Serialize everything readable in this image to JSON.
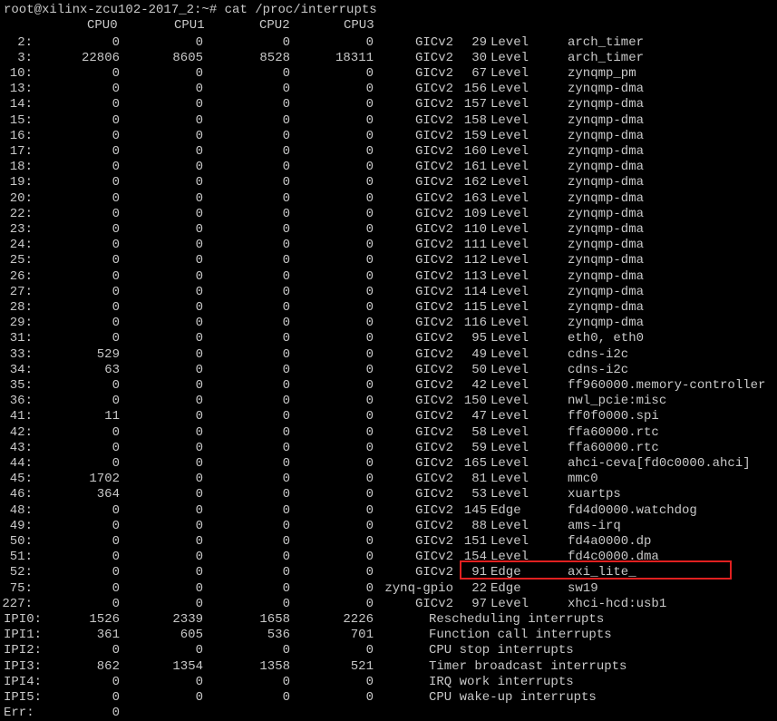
{
  "prompt": "root@xilinx-zcu102-2017_2:~# cat /proc/interrupts",
  "header": [
    "CPU0",
    "CPU1",
    "CPU2",
    "CPU3"
  ],
  "rows": [
    {
      "irq": "2:",
      "c0": "0",
      "c1": "0",
      "c2": "0",
      "c3": "0",
      "chip": "GICv2",
      "hw": "29",
      "type": "Level",
      "name": "arch_timer"
    },
    {
      "irq": "3:",
      "c0": "22806",
      "c1": "8605",
      "c2": "8528",
      "c3": "18311",
      "chip": "GICv2",
      "hw": "30",
      "type": "Level",
      "name": "arch_timer"
    },
    {
      "irq": "10:",
      "c0": "0",
      "c1": "0",
      "c2": "0",
      "c3": "0",
      "chip": "GICv2",
      "hw": "67",
      "type": "Level",
      "name": "zynqmp_pm"
    },
    {
      "irq": "13:",
      "c0": "0",
      "c1": "0",
      "c2": "0",
      "c3": "0",
      "chip": "GICv2",
      "hw": "156",
      "type": "Level",
      "name": "zynqmp-dma"
    },
    {
      "irq": "14:",
      "c0": "0",
      "c1": "0",
      "c2": "0",
      "c3": "0",
      "chip": "GICv2",
      "hw": "157",
      "type": "Level",
      "name": "zynqmp-dma"
    },
    {
      "irq": "15:",
      "c0": "0",
      "c1": "0",
      "c2": "0",
      "c3": "0",
      "chip": "GICv2",
      "hw": "158",
      "type": "Level",
      "name": "zynqmp-dma"
    },
    {
      "irq": "16:",
      "c0": "0",
      "c1": "0",
      "c2": "0",
      "c3": "0",
      "chip": "GICv2",
      "hw": "159",
      "type": "Level",
      "name": "zynqmp-dma"
    },
    {
      "irq": "17:",
      "c0": "0",
      "c1": "0",
      "c2": "0",
      "c3": "0",
      "chip": "GICv2",
      "hw": "160",
      "type": "Level",
      "name": "zynqmp-dma"
    },
    {
      "irq": "18:",
      "c0": "0",
      "c1": "0",
      "c2": "0",
      "c3": "0",
      "chip": "GICv2",
      "hw": "161",
      "type": "Level",
      "name": "zynqmp-dma"
    },
    {
      "irq": "19:",
      "c0": "0",
      "c1": "0",
      "c2": "0",
      "c3": "0",
      "chip": "GICv2",
      "hw": "162",
      "type": "Level",
      "name": "zynqmp-dma"
    },
    {
      "irq": "20:",
      "c0": "0",
      "c1": "0",
      "c2": "0",
      "c3": "0",
      "chip": "GICv2",
      "hw": "163",
      "type": "Level",
      "name": "zynqmp-dma"
    },
    {
      "irq": "22:",
      "c0": "0",
      "c1": "0",
      "c2": "0",
      "c3": "0",
      "chip": "GICv2",
      "hw": "109",
      "type": "Level",
      "name": "zynqmp-dma"
    },
    {
      "irq": "23:",
      "c0": "0",
      "c1": "0",
      "c2": "0",
      "c3": "0",
      "chip": "GICv2",
      "hw": "110",
      "type": "Level",
      "name": "zynqmp-dma"
    },
    {
      "irq": "24:",
      "c0": "0",
      "c1": "0",
      "c2": "0",
      "c3": "0",
      "chip": "GICv2",
      "hw": "111",
      "type": "Level",
      "name": "zynqmp-dma"
    },
    {
      "irq": "25:",
      "c0": "0",
      "c1": "0",
      "c2": "0",
      "c3": "0",
      "chip": "GICv2",
      "hw": "112",
      "type": "Level",
      "name": "zynqmp-dma"
    },
    {
      "irq": "26:",
      "c0": "0",
      "c1": "0",
      "c2": "0",
      "c3": "0",
      "chip": "GICv2",
      "hw": "113",
      "type": "Level",
      "name": "zynqmp-dma"
    },
    {
      "irq": "27:",
      "c0": "0",
      "c1": "0",
      "c2": "0",
      "c3": "0",
      "chip": "GICv2",
      "hw": "114",
      "type": "Level",
      "name": "zynqmp-dma"
    },
    {
      "irq": "28:",
      "c0": "0",
      "c1": "0",
      "c2": "0",
      "c3": "0",
      "chip": "GICv2",
      "hw": "115",
      "type": "Level",
      "name": "zynqmp-dma"
    },
    {
      "irq": "29:",
      "c0": "0",
      "c1": "0",
      "c2": "0",
      "c3": "0",
      "chip": "GICv2",
      "hw": "116",
      "type": "Level",
      "name": "zynqmp-dma"
    },
    {
      "irq": "31:",
      "c0": "0",
      "c1": "0",
      "c2": "0",
      "c3": "0",
      "chip": "GICv2",
      "hw": "95",
      "type": "Level",
      "name": "eth0, eth0"
    },
    {
      "irq": "33:",
      "c0": "529",
      "c1": "0",
      "c2": "0",
      "c3": "0",
      "chip": "GICv2",
      "hw": "49",
      "type": "Level",
      "name": "cdns-i2c"
    },
    {
      "irq": "34:",
      "c0": "63",
      "c1": "0",
      "c2": "0",
      "c3": "0",
      "chip": "GICv2",
      "hw": "50",
      "type": "Level",
      "name": "cdns-i2c"
    },
    {
      "irq": "35:",
      "c0": "0",
      "c1": "0",
      "c2": "0",
      "c3": "0",
      "chip": "GICv2",
      "hw": "42",
      "type": "Level",
      "name": "ff960000.memory-controller"
    },
    {
      "irq": "36:",
      "c0": "0",
      "c1": "0",
      "c2": "0",
      "c3": "0",
      "chip": "GICv2",
      "hw": "150",
      "type": "Level",
      "name": "nwl_pcie:misc"
    },
    {
      "irq": "41:",
      "c0": "11",
      "c1": "0",
      "c2": "0",
      "c3": "0",
      "chip": "GICv2",
      "hw": "47",
      "type": "Level",
      "name": "ff0f0000.spi"
    },
    {
      "irq": "42:",
      "c0": "0",
      "c1": "0",
      "c2": "0",
      "c3": "0",
      "chip": "GICv2",
      "hw": "58",
      "type": "Level",
      "name": "ffa60000.rtc"
    },
    {
      "irq": "43:",
      "c0": "0",
      "c1": "0",
      "c2": "0",
      "c3": "0",
      "chip": "GICv2",
      "hw": "59",
      "type": "Level",
      "name": "ffa60000.rtc"
    },
    {
      "irq": "44:",
      "c0": "0",
      "c1": "0",
      "c2": "0",
      "c3": "0",
      "chip": "GICv2",
      "hw": "165",
      "type": "Level",
      "name": "ahci-ceva[fd0c0000.ahci]"
    },
    {
      "irq": "45:",
      "c0": "1702",
      "c1": "0",
      "c2": "0",
      "c3": "0",
      "chip": "GICv2",
      "hw": "81",
      "type": "Level",
      "name": "mmc0"
    },
    {
      "irq": "46:",
      "c0": "364",
      "c1": "0",
      "c2": "0",
      "c3": "0",
      "chip": "GICv2",
      "hw": "53",
      "type": "Level",
      "name": "xuartps"
    },
    {
      "irq": "48:",
      "c0": "0",
      "c1": "0",
      "c2": "0",
      "c3": "0",
      "chip": "GICv2",
      "hw": "145",
      "type": "Edge",
      "name": "fd4d0000.watchdog"
    },
    {
      "irq": "49:",
      "c0": "0",
      "c1": "0",
      "c2": "0",
      "c3": "0",
      "chip": "GICv2",
      "hw": "88",
      "type": "Level",
      "name": "ams-irq"
    },
    {
      "irq": "50:",
      "c0": "0",
      "c1": "0",
      "c2": "0",
      "c3": "0",
      "chip": "GICv2",
      "hw": "151",
      "type": "Level",
      "name": "fd4a0000.dp"
    },
    {
      "irq": "51:",
      "c0": "0",
      "c1": "0",
      "c2": "0",
      "c3": "0",
      "chip": "GICv2",
      "hw": "154",
      "type": "Level",
      "name": "fd4c0000.dma"
    },
    {
      "irq": "52:",
      "c0": "0",
      "c1": "0",
      "c2": "0",
      "c3": "0",
      "chip": "GICv2",
      "hw": "91",
      "type": "Edge",
      "name": "axi_lite_"
    },
    {
      "irq": "75:",
      "c0": "0",
      "c1": "0",
      "c2": "0",
      "c3": "0",
      "chip": "zynq-gpio",
      "hw": "22",
      "type": "Edge",
      "name": "sw19"
    },
    {
      "irq": "227:",
      "c0": "0",
      "c1": "0",
      "c2": "0",
      "c3": "0",
      "chip": "GICv2",
      "hw": "97",
      "type": "Level",
      "name": "xhci-hcd:usb1"
    }
  ],
  "ipi_rows": [
    {
      "irq": "IPI0:",
      "c0": "1526",
      "c1": "2339",
      "c2": "1658",
      "c3": "2226",
      "desc": "Rescheduling interrupts"
    },
    {
      "irq": "IPI1:",
      "c0": "361",
      "c1": "605",
      "c2": "536",
      "c3": "701",
      "desc": "Function call interrupts"
    },
    {
      "irq": "IPI2:",
      "c0": "0",
      "c1": "0",
      "c2": "0",
      "c3": "0",
      "desc": "CPU stop interrupts"
    },
    {
      "irq": "IPI3:",
      "c0": "862",
      "c1": "1354",
      "c2": "1358",
      "c3": "521",
      "desc": "Timer broadcast interrupts"
    },
    {
      "irq": "IPI4:",
      "c0": "0",
      "c1": "0",
      "c2": "0",
      "c3": "0",
      "desc": "IRQ work interrupts"
    },
    {
      "irq": "IPI5:",
      "c0": "0",
      "c1": "0",
      "c2": "0",
      "c3": "0",
      "desc": "CPU wake-up interrupts"
    }
  ],
  "err": {
    "irq": "Err:",
    "c0": "0"
  },
  "highlight_color": "#e02020"
}
